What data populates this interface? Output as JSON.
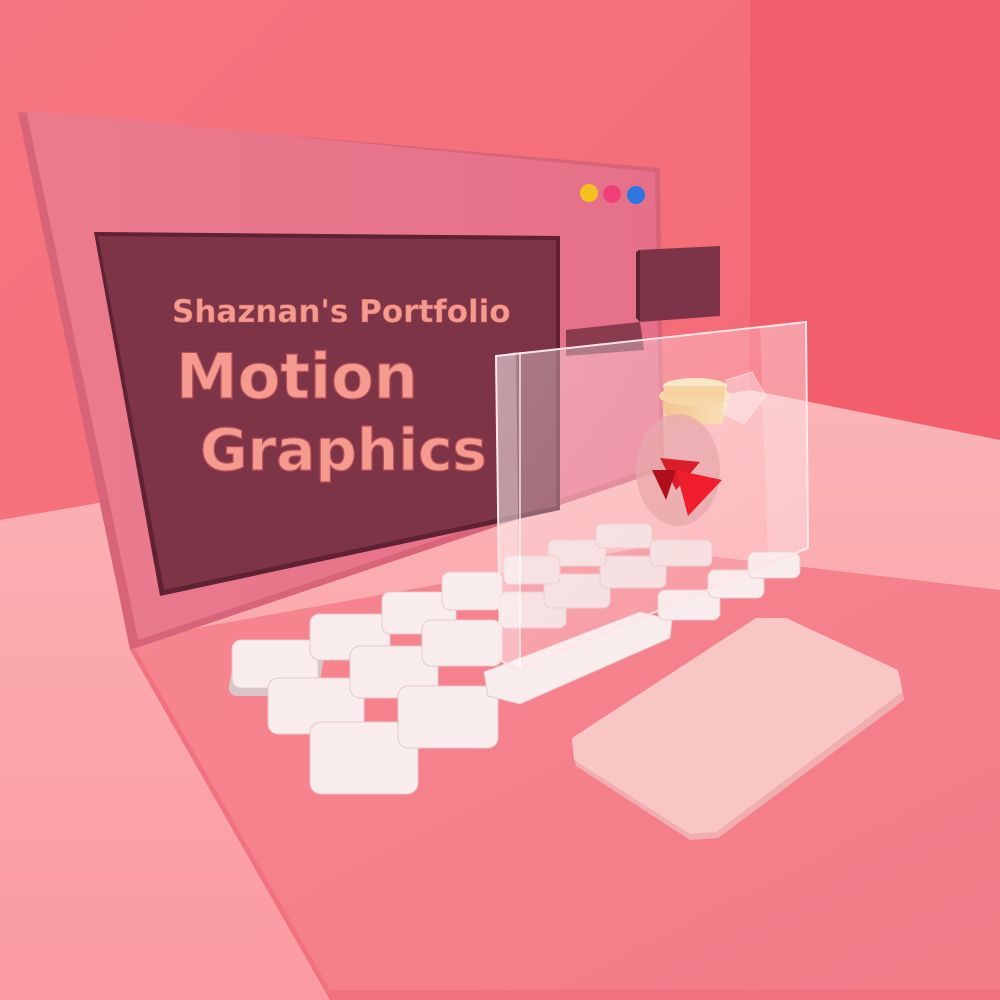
{
  "screen": {
    "subtitle": "Shaznan's Portfolio",
    "title_line1": "Motion",
    "title_line2": "Graphics"
  },
  "window_controls": [
    {
      "name": "yellow-dot",
      "color": "#f5c020"
    },
    {
      "name": "pink-dot",
      "color": "#f0407a"
    },
    {
      "name": "blue-dot",
      "color": "#2d78e0"
    }
  ],
  "colors": {
    "wall": "#f4707a",
    "floor": "#fba0a6",
    "laptop_body": "#f4808e",
    "laptop_lid": "#e9788a",
    "screen_panel": "#7c3446",
    "text": "#f59a8e",
    "keys": "#fbe9ea",
    "trackpad": "#f8c7c5",
    "play_accent": "#f01e2c",
    "cup_lid": "#f7d7a8"
  },
  "icons": [
    "play-icon",
    "coffee-cup-icon",
    "ice-cube-icon"
  ]
}
